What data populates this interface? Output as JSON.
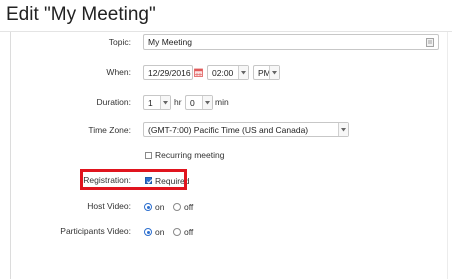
{
  "page": {
    "title": "Edit \"My Meeting\""
  },
  "topic": {
    "label": "Topic:",
    "value": "My Meeting"
  },
  "when": {
    "label": "When:",
    "date": "12/29/2016",
    "time": "02:00",
    "ampm": "PM"
  },
  "duration": {
    "label": "Duration:",
    "hours": "1",
    "hr_label": "hr",
    "minutes": "0",
    "min_label": "min"
  },
  "timezone": {
    "label": "Time Zone:",
    "value": "(GMT-7:00) Pacific Time (US and Canada)"
  },
  "recurring": {
    "label": "Recurring meeting",
    "checked": false
  },
  "registration": {
    "label": "Registration:",
    "option_label": "Required",
    "checked": true
  },
  "host_video": {
    "label": "Host Video:",
    "on_label": "on",
    "off_label": "off",
    "selected": "on"
  },
  "participants_video": {
    "label": "Participants Video:",
    "on_label": "on",
    "off_label": "off",
    "selected": "on"
  },
  "colors": {
    "accent": "#2d6fcf",
    "highlight": "#e0141e",
    "calendar": "#e05a5a"
  },
  "icons": {
    "topic_field": "notepad-icon",
    "date_picker": "calendar-icon",
    "dropdown": "chevron-down-icon",
    "checkbox_mark": "checkmark-icon"
  }
}
